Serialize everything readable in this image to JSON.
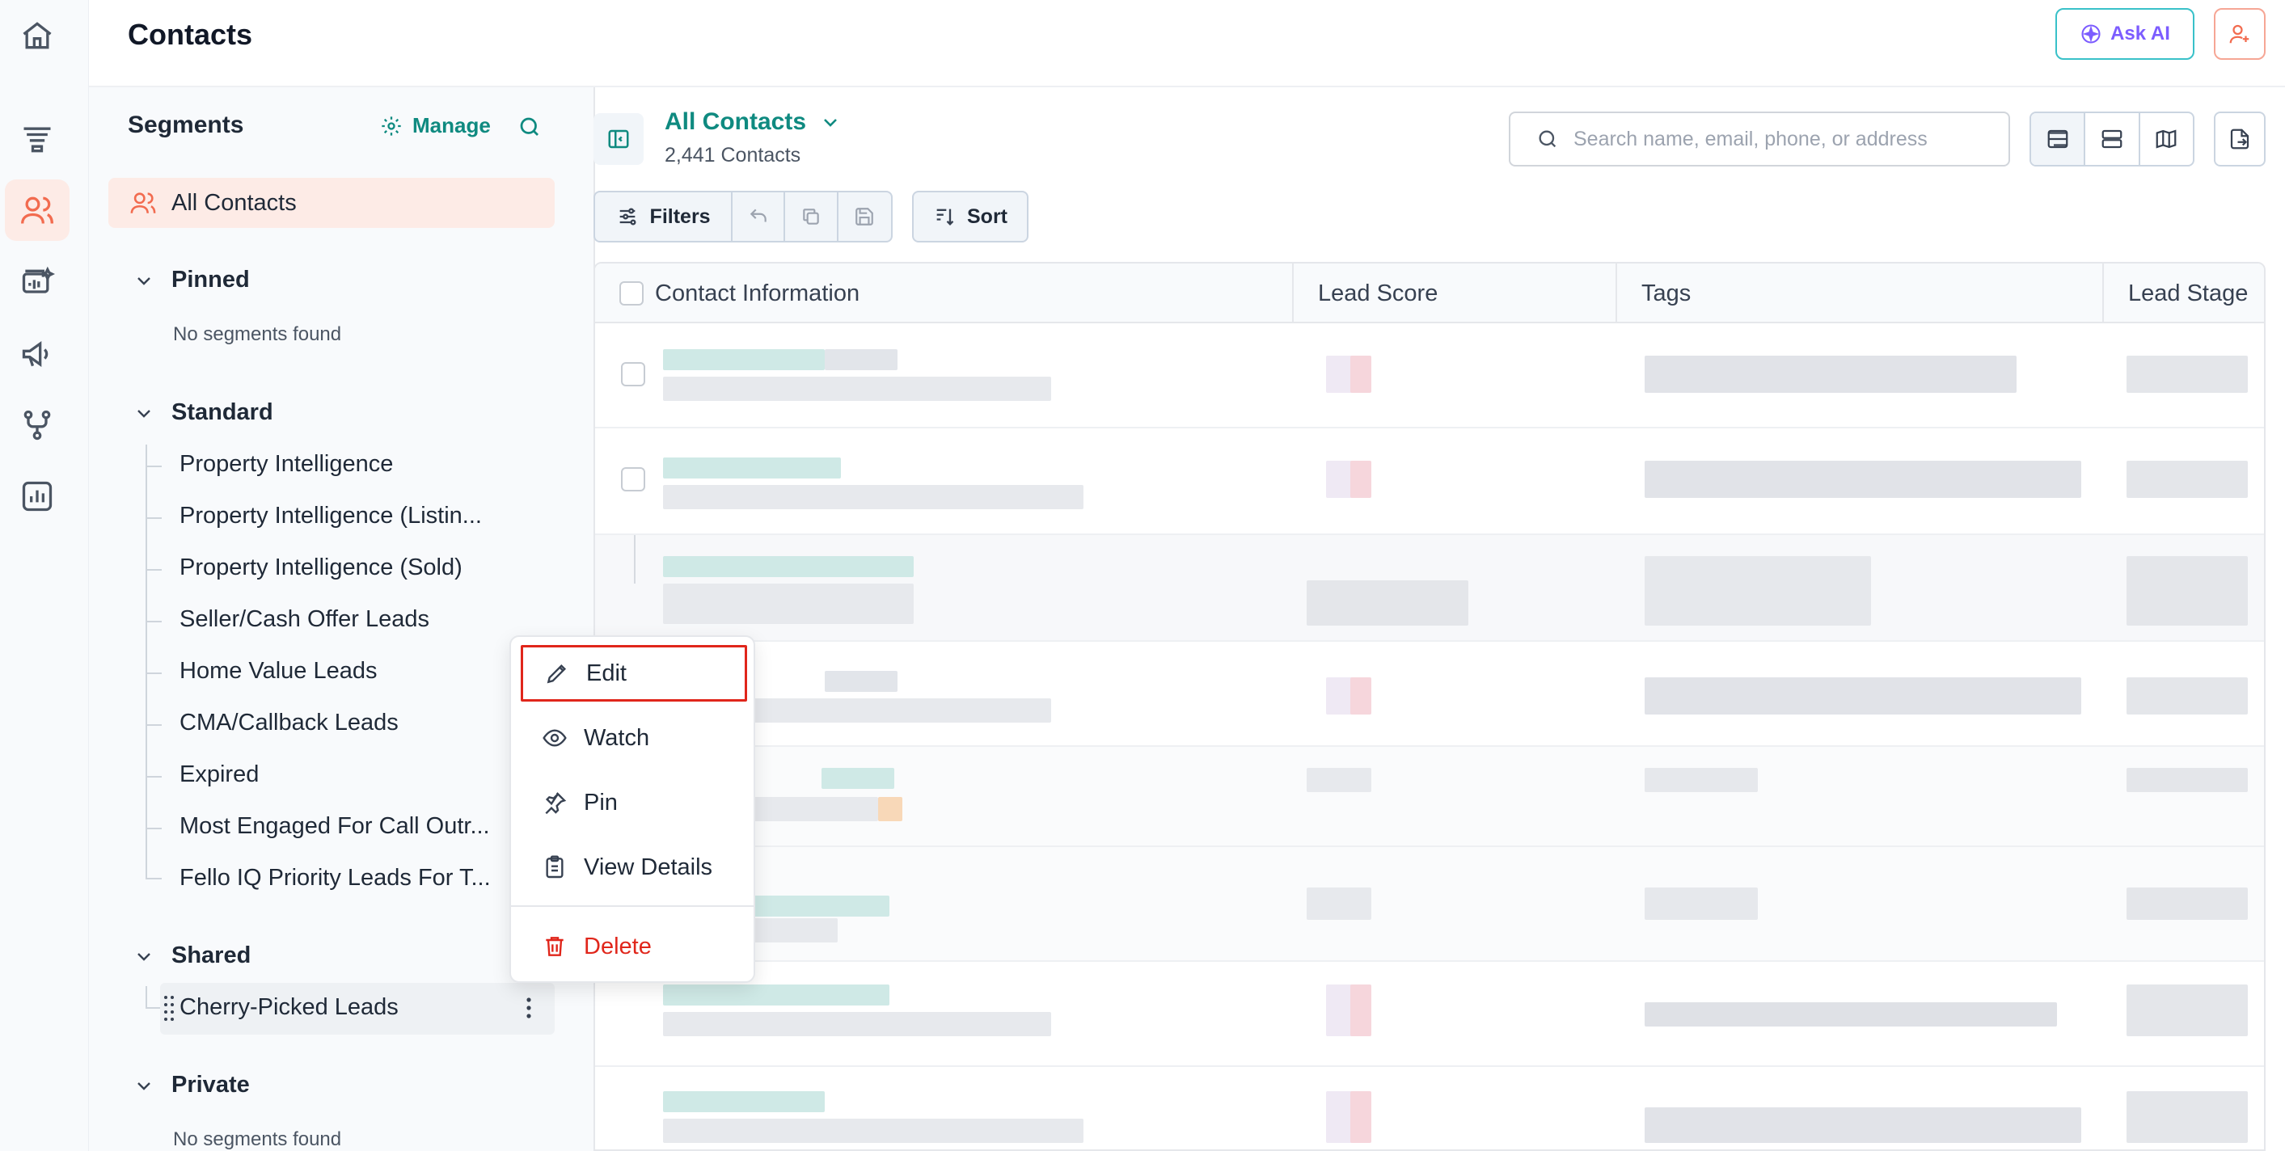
{
  "header": {
    "title": "Contacts",
    "ask_ai": "Ask AI"
  },
  "rail": {
    "icons": [
      "home-icon",
      "funnel-icon",
      "contacts-icon",
      "conversations-icon",
      "campaigns-icon",
      "workflows-icon",
      "reports-icon"
    ],
    "active": "contacts-icon"
  },
  "segments": {
    "title": "Segments",
    "manage": "Manage",
    "all_contacts": "All Contacts",
    "pinned": {
      "label": "Pinned",
      "empty": "No segments found"
    },
    "standard": {
      "label": "Standard",
      "items": [
        "Property Intelligence",
        "Property Intelligence (Listin...",
        "Property Intelligence (Sold)",
        "Seller/Cash Offer Leads",
        "Home Value Leads",
        "CMA/Callback Leads",
        "Expired",
        "Most Engaged For Call Outr...",
        "Fello IQ Priority Leads For T..."
      ]
    },
    "shared": {
      "label": "Shared",
      "items": [
        "Cherry-Picked Leads"
      ]
    },
    "private": {
      "label": "Private",
      "empty": "No segments found"
    }
  },
  "view": {
    "title": "All Contacts",
    "count": "2,441 Contacts"
  },
  "search": {
    "placeholder": "Search name, email, phone, or address"
  },
  "toolbar": {
    "filters": "Filters",
    "sort": "Sort"
  },
  "table": {
    "columns": [
      "Contact Information",
      "Lead Score",
      "Tags",
      "Lead Stage"
    ]
  },
  "context_menu": {
    "items": [
      {
        "label": "Edit",
        "icon": "pencil-icon"
      },
      {
        "label": "Watch",
        "icon": "eye-icon"
      },
      {
        "label": "Pin",
        "icon": "pin-icon"
      },
      {
        "label": "View Details",
        "icon": "clipboard-icon"
      },
      {
        "label": "Delete",
        "icon": "trash-icon"
      }
    ]
  },
  "colors": {
    "accent": "#0f8a80",
    "brand_orange": "#f26b4f",
    "danger": "#e0261b",
    "highlight_bg": "#fdebe6"
  }
}
